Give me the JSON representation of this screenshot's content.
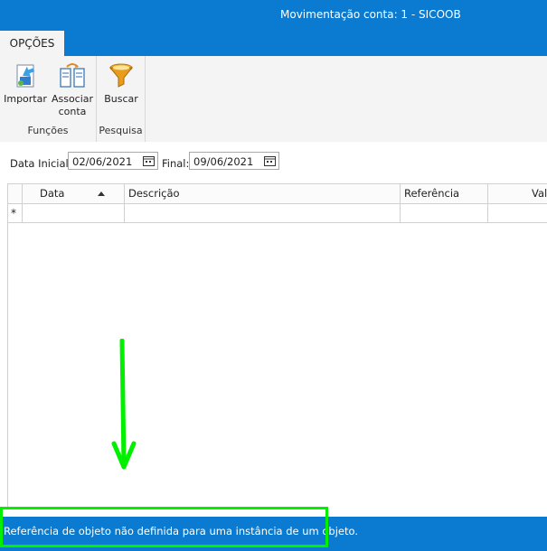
{
  "window": {
    "title": "Movimentação conta: 1 - SICOOB"
  },
  "ribbon": {
    "tab_label": "OPÇÕES",
    "groups": [
      {
        "label": "Funções",
        "buttons": [
          {
            "label_line1": "Importar",
            "icon": "import-icon"
          },
          {
            "label_line1": "Associar",
            "label_line2": "conta",
            "icon": "associate-account-icon"
          }
        ]
      },
      {
        "label": "Pesquisa",
        "buttons": [
          {
            "label_line1": "Buscar",
            "icon": "funnel-filter-icon"
          }
        ]
      }
    ]
  },
  "filter": {
    "initial_label": "Data Inicial:",
    "initial_value": "02/06/2021",
    "final_label": "Final:",
    "final_value": "09/06/2021"
  },
  "grid": {
    "columns": [
      "Data",
      "Descrição",
      "Referência",
      "Valo"
    ],
    "sorted_column": "Data",
    "new_row_marker": "*"
  },
  "status": {
    "message": "Referência de objeto não definida para uma instância de um objeto."
  },
  "colors": {
    "accent": "#0a7bd0",
    "highlight": "#00f000"
  }
}
